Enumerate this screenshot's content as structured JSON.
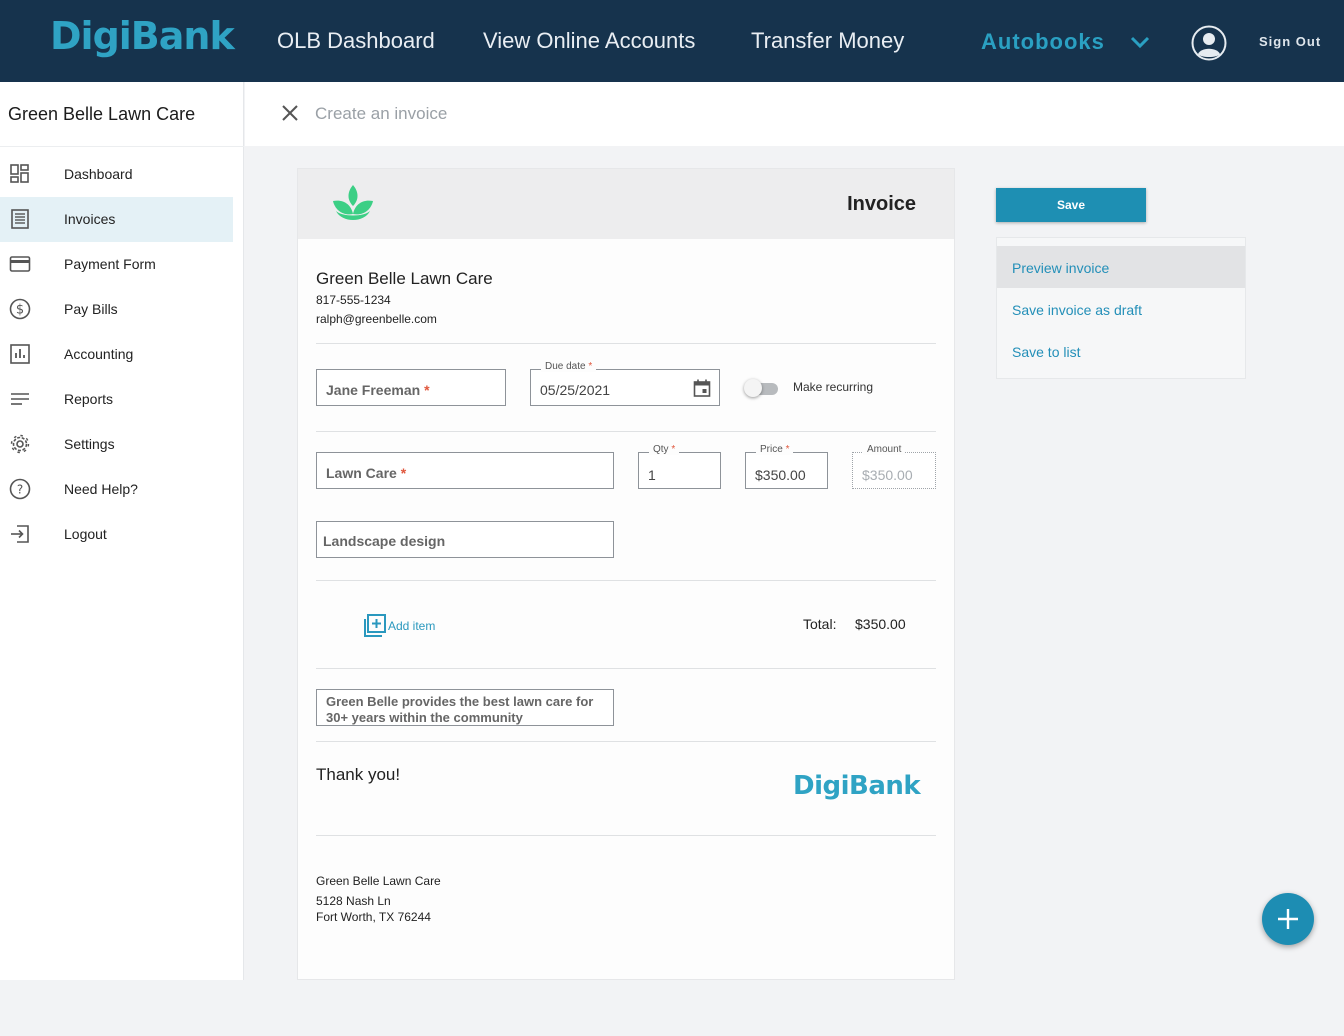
{
  "nav": {
    "logo": "DigiBank",
    "links": [
      "OLB Dashboard",
      "View Online Accounts",
      "Transfer Money"
    ],
    "autobooks": "Autobooks",
    "sign_out": "Sign Out"
  },
  "sidebar": {
    "business_name": "Green Belle Lawn Care",
    "items": [
      {
        "label": "Dashboard",
        "icon": "dashboard-icon"
      },
      {
        "label": "Invoices",
        "icon": "invoices-icon",
        "active": true
      },
      {
        "label": "Payment Form",
        "icon": "credit-card-icon"
      },
      {
        "label": "Pay Bills",
        "icon": "dollar-circle-icon"
      },
      {
        "label": "Accounting",
        "icon": "bar-chart-icon"
      },
      {
        "label": "Reports",
        "icon": "reports-icon"
      },
      {
        "label": "Settings",
        "icon": "gear-icon"
      },
      {
        "label": "Need Help?",
        "icon": "help-icon"
      },
      {
        "label": "Logout",
        "icon": "logout-icon"
      }
    ]
  },
  "page": {
    "title": "Create an invoice"
  },
  "invoice": {
    "heading": "Invoice",
    "company": {
      "name": "Green Belle Lawn Care",
      "phone": "817-555-1234",
      "email": "ralph@greenbelle.com"
    },
    "customer": {
      "value": "Jane Freeman",
      "required": "*"
    },
    "due_date": {
      "label": "Due date",
      "required": "*",
      "value": "05/25/2021"
    },
    "recurring": {
      "label": "Make recurring",
      "on": false
    },
    "line_item": {
      "product": {
        "value": "Lawn Care",
        "required": "*"
      },
      "qty": {
        "label": "Qty",
        "required": "*",
        "value": "1"
      },
      "price": {
        "label": "Price",
        "required": "*",
        "value": "$350.00"
      },
      "amount": {
        "label": "Amount",
        "value": "$350.00"
      },
      "description": "Landscape design"
    },
    "add_item": "Add item",
    "total_label": "Total:",
    "total_value": "$350.00",
    "notes": "Green Belle provides the best lawn care for 30+ years within the community",
    "thank_you": "Thank you!",
    "footer_logo": "DigiBank",
    "address": {
      "name": "Green Belle Lawn Care",
      "street": "5128 Nash Ln",
      "city": "Fort Worth, TX 76244"
    }
  },
  "panel": {
    "save": "Save",
    "actions": [
      "Preview invoice",
      "Save invoice as draft",
      "Save to list"
    ]
  },
  "colors": {
    "nav_bg": "#16334d",
    "brand": "#2fa3c4",
    "primary_button": "#1e8fb3",
    "required": "#e0573d",
    "leaf": "#3ccf85"
  }
}
